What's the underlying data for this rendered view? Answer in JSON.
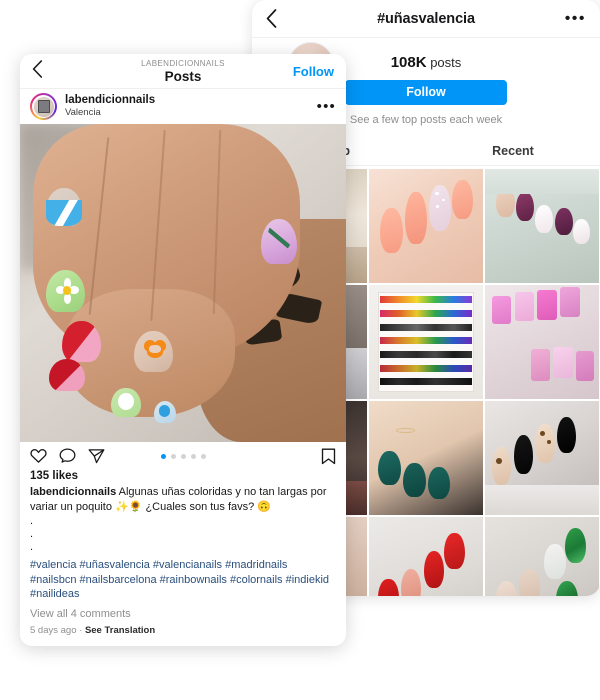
{
  "hashtag_panel": {
    "back_icon": "chevron-left-icon",
    "title": "#uñasvalencia",
    "more_icon": "ellipsis-icon",
    "post_count": "108K",
    "post_count_label": "posts",
    "follow_label": "Follow",
    "subtitle": "See a few top posts each week",
    "tabs": [
      {
        "label": "Top"
      },
      {
        "label": "Recent"
      }
    ],
    "accent_color": "#0095F6",
    "grid": [
      {
        "name": "thumb-left-column-1",
        "art": "t-left1"
      },
      {
        "name": "thumb-peach-almond-nails",
        "art": "t-peach"
      },
      {
        "name": "thumb-purple-glitter-nails",
        "art": "t-purple"
      },
      {
        "name": "thumb-left-column-2",
        "art": "t-left2"
      },
      {
        "name": "thumb-polish-shelf",
        "art": "t-shelf"
      },
      {
        "name": "thumb-pink-long-nails",
        "art": "t-pinkl"
      },
      {
        "name": "thumb-left-column-3",
        "art": "t-left3"
      },
      {
        "name": "thumb-teal-green-nails",
        "art": "t-teal"
      },
      {
        "name": "thumb-leopard-black-nails",
        "art": "t-leopard"
      },
      {
        "name": "thumb-left-column-4",
        "art": "t-left4"
      },
      {
        "name": "thumb-red-almond-nails",
        "art": "t-red"
      },
      {
        "name": "thumb-green-marble-nails",
        "art": "t-green"
      }
    ]
  },
  "post_card": {
    "back_icon": "chevron-left-icon",
    "eyebrow": "LABENDICIONNAILS",
    "title": "Posts",
    "follow_label": "Follow",
    "username": "labendicionnails",
    "location": "Valencia",
    "more_icon": "ellipsis-icon",
    "avatar_icon": "profile-avatar",
    "actions": {
      "like_icon": "heart-icon",
      "comment_icon": "comment-icon",
      "share_icon": "share-paper-plane-icon",
      "save_icon": "bookmark-icon"
    },
    "carousel_dots": 5,
    "carousel_active_index": 0,
    "likes": "135 likes",
    "caption_author": "labendicionnails",
    "caption_text": " Algunas uñas coloridas y no tan largas por variar un poquito ✨🌻 ¿Cuales son tus favs? 🙃",
    "caption_dot_lines": [
      ".",
      ".",
      "."
    ],
    "hashtags": "#valencia #uñasvalencia #valencianails #madridnails #nailsbcn #nailsbarcelona #rainbownails #colornails #indiekid #nailideas",
    "view_comments": "View all 4 comments",
    "timestamp": "5 days ago",
    "separator": "·",
    "see_translation": "See Translation"
  }
}
